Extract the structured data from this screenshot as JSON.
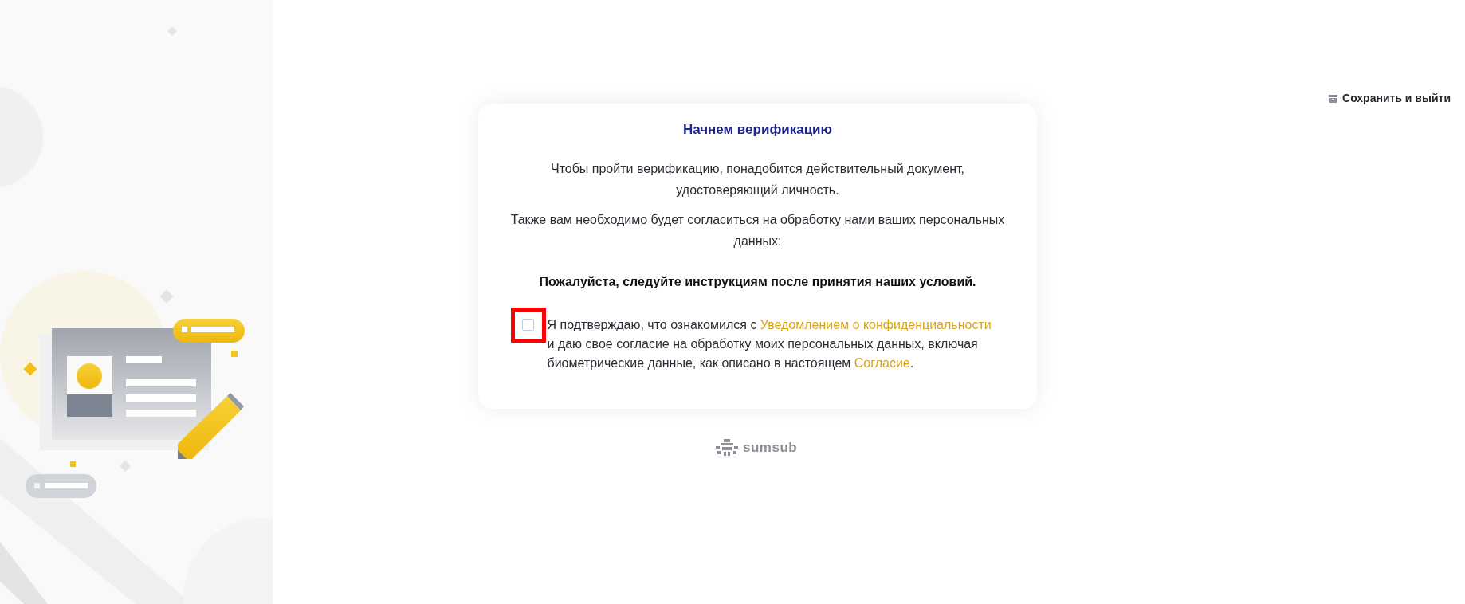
{
  "header": {
    "save_exit": "Сохранить и выйти"
  },
  "card": {
    "title": "Начнем верификацию",
    "paragraphs": [
      "Чтобы пройти верификацию, понадобится действительный документ, удостоверяющий личность.",
      "Также вам необходимо будет согласиться на обработку нами ваших персональных данных:"
    ],
    "notice": "Пожалуйста, следуйте инструкциям после принятия наших условий.",
    "consent": {
      "checked": false,
      "highlighted": true,
      "text_before": "Я подтверждаю, что ознакомился с",
      "link_1": "Уведомлением о конфиденциальности",
      "text_middle": "и даю свое согласие на обработку моих персональных данных, включая биометрические данные, как описано в настоящем",
      "link_2": "Согласие",
      "text_end": "."
    }
  },
  "footer": {
    "brand": "sumsub"
  }
}
